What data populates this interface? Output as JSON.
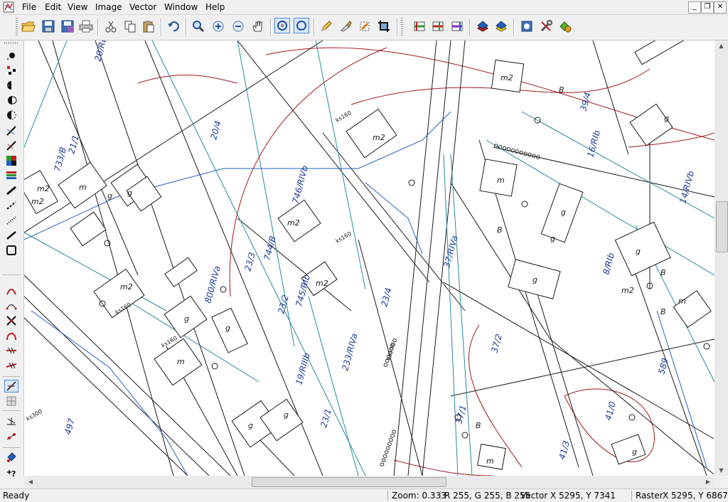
{
  "menu": {
    "items": [
      "File",
      "Edit",
      "View",
      "Image",
      "Vector",
      "Window",
      "Help"
    ]
  },
  "window_controls": {
    "minimize": "_",
    "restore": "❐",
    "close": "✕"
  },
  "map": {
    "parcel_labels": [
      "20/Rb",
      "21/1",
      "733/B",
      "20/4",
      "746/RIVb",
      "744/B",
      "23/3",
      "745/RIb",
      "23/2",
      "23/4",
      "800/RIVa",
      "19/RIIIb",
      "233/RIVa",
      "37/RIVa",
      "37/2",
      "37/1",
      "39/4",
      "16/RIb",
      "14/RIVb",
      "41/3",
      "41/0",
      "589",
      "8/RIb",
      "497",
      "23/1",
      "m2",
      "m",
      "g",
      "B",
      "ks160",
      "ks300"
    ]
  },
  "status": {
    "ready": "Ready",
    "zoom": "Zoom: 0.333",
    "rgb": "R 255, G 255, B 255",
    "vector_label": "Vector",
    "vector_coords": "X 5295, Y 7341",
    "raster_label": "Raster",
    "raster_coords": "X 5295, Y 6867"
  },
  "colors": {
    "canvas": "#ffffff",
    "line_black": "#1a1a1a",
    "line_teal": "#2a8a9a",
    "line_blue": "#2060c0",
    "line_red": "#a01818",
    "text_blue": "#1a3a9a",
    "ui_bg": "#f0f0f0",
    "ui_pressed": "#dbe8f7"
  }
}
